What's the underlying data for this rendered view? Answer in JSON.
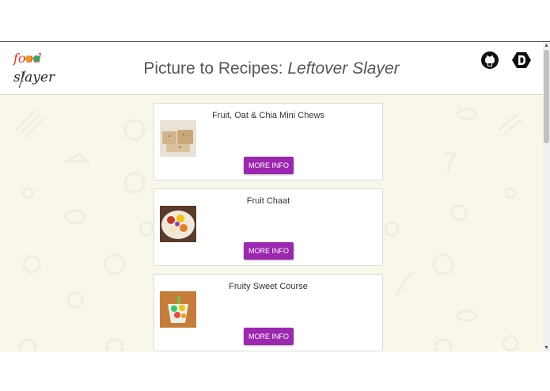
{
  "header": {
    "title_main": "Picture to Recipes: ",
    "title_italic": "Leftover Slayer",
    "logo_line1": "food",
    "logo_line2": "slayer"
  },
  "icons": {
    "github": "github-icon",
    "devpost": "devpost-icon"
  },
  "recipes": [
    {
      "title": "Fruit, Oat & Chia Mini Chews",
      "button_label": "MORE INFO"
    },
    {
      "title": "Fruit Chaat",
      "button_label": "MORE INFO"
    },
    {
      "title": "Fruity Sweet Course",
      "button_label": "MORE INFO"
    }
  ],
  "colors": {
    "accent": "#9c27b0",
    "background": "#f8f7e9",
    "header_text": "#555555"
  }
}
